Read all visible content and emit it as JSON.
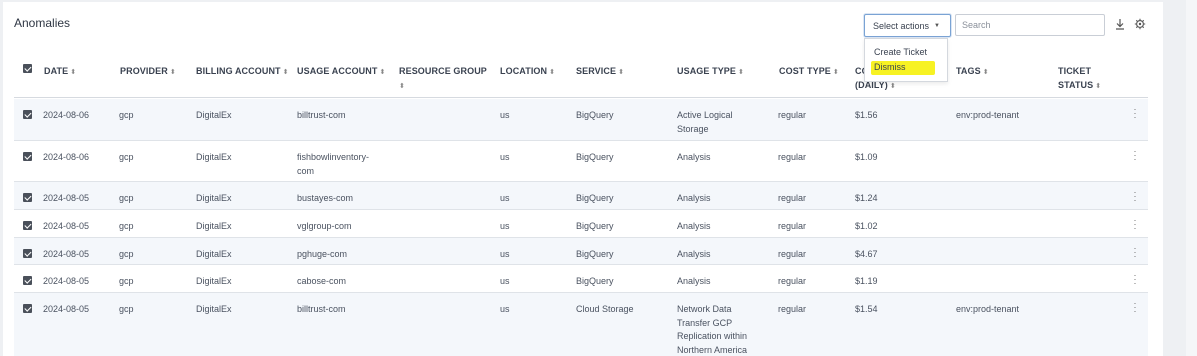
{
  "title": "Anomalies",
  "toolbar": {
    "select_actions_label": "Select actions",
    "search_placeholder": "Search",
    "download_icon": "download-icon",
    "gear_icon": "gear-icon"
  },
  "dropdown": {
    "options": [
      "Create Ticket",
      "Dismiss"
    ],
    "highlight_color": "#f7f223"
  },
  "table": {
    "columns": [
      "DATE",
      "PROVIDER",
      "BILLING ACCOUNT",
      "USAGE ACCOUNT",
      "RESOURCE GROUP",
      "LOCATION",
      "SERVICE",
      "USAGE TYPE",
      "COST TYPE",
      "CO",
      "(DAILY)",
      "TAGS",
      "TICKET",
      "STATUS"
    ],
    "rows": [
      {
        "date": "2024-08-06",
        "provider": "gcp",
        "billing": "DigitalEx",
        "usage_account": "billtrust-com",
        "usage_account2": "",
        "location": "us",
        "service": "BigQuery",
        "usage_type": [
          "Active Logical",
          "Storage"
        ],
        "cost_type": "regular",
        "cost": "$1.56",
        "tags": "env:prod-tenant"
      },
      {
        "date": "2024-08-06",
        "provider": "gcp",
        "billing": "DigitalEx",
        "usage_account": "fishbowlinventory-",
        "usage_account2": "com",
        "location": "us",
        "service": "BigQuery",
        "usage_type": [
          "Analysis"
        ],
        "cost_type": "regular",
        "cost": "$1.09",
        "tags": ""
      },
      {
        "date": "2024-08-05",
        "provider": "gcp",
        "billing": "DigitalEx",
        "usage_account": "bustayes-com",
        "usage_account2": "",
        "location": "us",
        "service": "BigQuery",
        "usage_type": [
          "Analysis"
        ],
        "cost_type": "regular",
        "cost": "$1.24",
        "tags": ""
      },
      {
        "date": "2024-08-05",
        "provider": "gcp",
        "billing": "DigitalEx",
        "usage_account": "vglgroup-com",
        "usage_account2": "",
        "location": "us",
        "service": "BigQuery",
        "usage_type": [
          "Analysis"
        ],
        "cost_type": "regular",
        "cost": "$1.02",
        "tags": ""
      },
      {
        "date": "2024-08-05",
        "provider": "gcp",
        "billing": "DigitalEx",
        "usage_account": "pghuge-com",
        "usage_account2": "",
        "location": "us",
        "service": "BigQuery",
        "usage_type": [
          "Analysis"
        ],
        "cost_type": "regular",
        "cost": "$4.67",
        "tags": ""
      },
      {
        "date": "2024-08-05",
        "provider": "gcp",
        "billing": "DigitalEx",
        "usage_account": "cabose-com",
        "usage_account2": "",
        "location": "us",
        "service": "BigQuery",
        "usage_type": [
          "Analysis"
        ],
        "cost_type": "regular",
        "cost": "$1.19",
        "tags": ""
      },
      {
        "date": "2024-08-05",
        "provider": "gcp",
        "billing": "DigitalEx",
        "usage_account": "billtrust-com",
        "usage_account2": "",
        "location": "us",
        "service": "Cloud Storage",
        "usage_type": [
          "Network Data",
          "Transfer GCP",
          "Replication within",
          "Northern America"
        ],
        "cost_type": "regular",
        "cost": "$1.54",
        "tags": "env:prod-tenant"
      }
    ]
  }
}
